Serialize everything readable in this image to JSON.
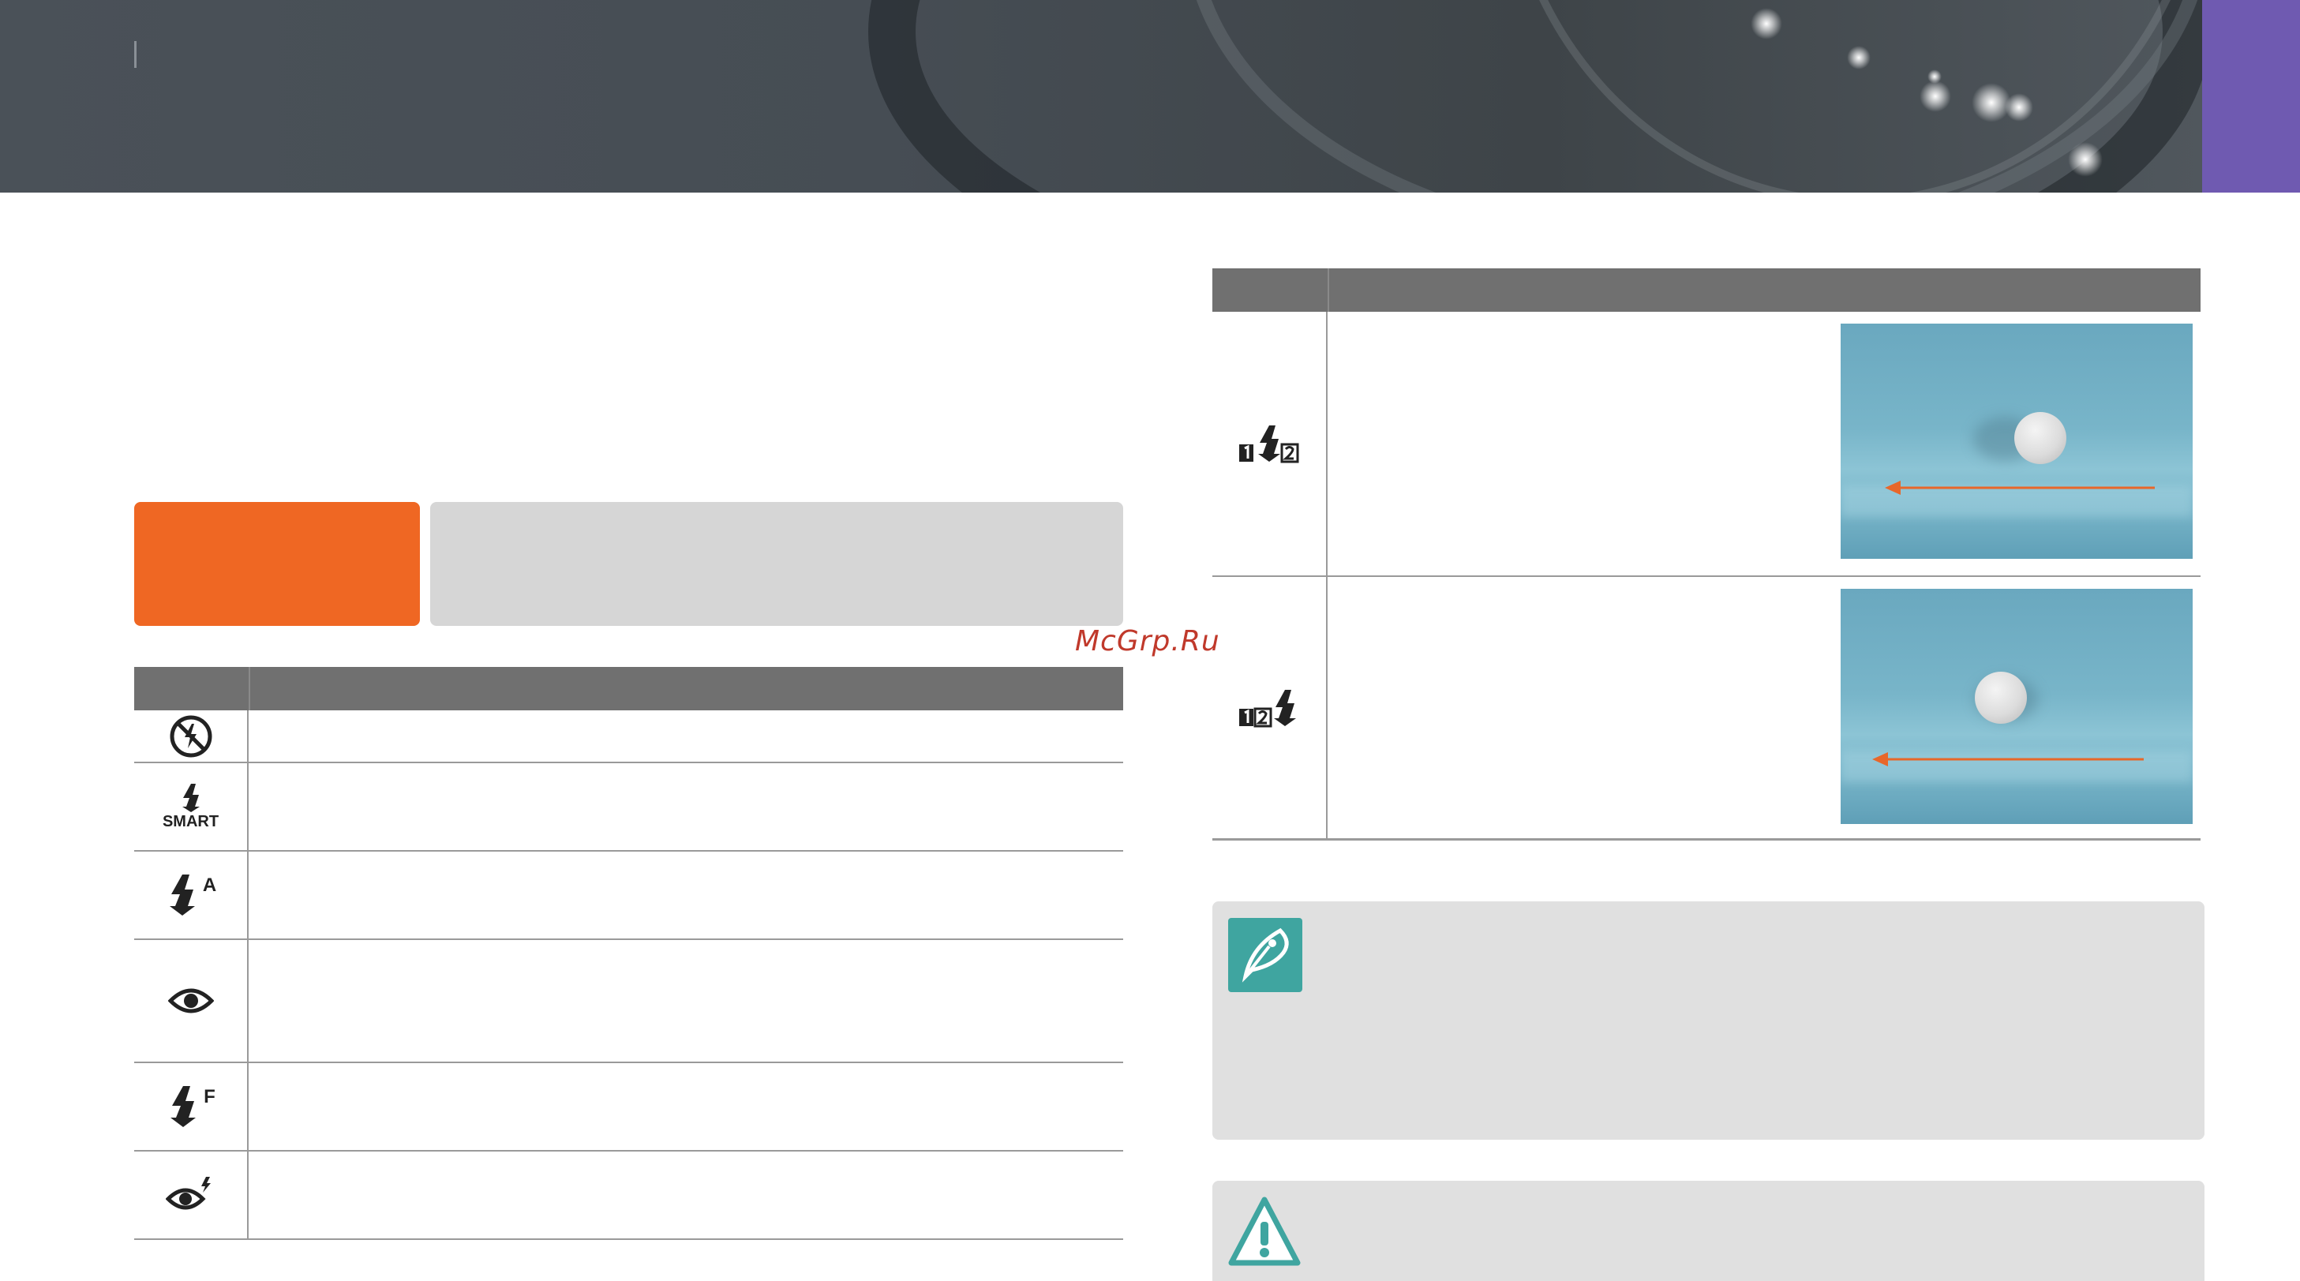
{
  "banner": {
    "title": ""
  },
  "flash_tabs": {
    "primary": "",
    "secondary": ""
  },
  "watermark": "McGrp.Ru",
  "left_table": {
    "header": [
      "",
      ""
    ],
    "rows": [
      {
        "icon": "flash-off-icon",
        "icon_text": "",
        "text": ""
      },
      {
        "icon": "smart-flash-icon",
        "icon_text": "SMART",
        "text": ""
      },
      {
        "icon": "auto-flash-icon",
        "icon_text": "A",
        "text": ""
      },
      {
        "icon": "red-eye-icon",
        "icon_text": "",
        "text": ""
      },
      {
        "icon": "fill-in-flash-icon",
        "icon_text": "F",
        "text": ""
      },
      {
        "icon": "red-eye-fix-icon",
        "icon_text": "",
        "text": ""
      }
    ]
  },
  "right_table": {
    "header": [
      "",
      ""
    ],
    "rows": [
      {
        "icon": "first-curtain-flash-icon",
        "text": "",
        "photo": "ball-motion-first-curtain"
      },
      {
        "icon": "second-curtain-flash-icon",
        "text": "",
        "photo": "ball-motion-second-curtain"
      }
    ]
  },
  "note": {
    "icon": "note-pen-icon",
    "text": ""
  },
  "caution": {
    "icon": "caution-icon",
    "text": ""
  },
  "colors": {
    "banner": "#464d54",
    "tab": "#6f5ab1",
    "orange": "#ef6723",
    "table_header": "#707070",
    "note_bg": "#e0e0e0",
    "note_icon": "#3fa5a0",
    "arrow": "#e8672a"
  }
}
